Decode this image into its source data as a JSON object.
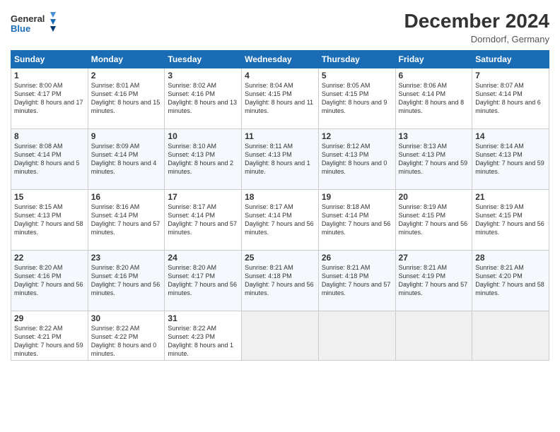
{
  "header": {
    "logo_line1": "General",
    "logo_line2": "Blue",
    "month_title": "December 2024",
    "location": "Dorndorf, Germany"
  },
  "days_of_week": [
    "Sunday",
    "Monday",
    "Tuesday",
    "Wednesday",
    "Thursday",
    "Friday",
    "Saturday"
  ],
  "weeks": [
    [
      {
        "day": "1",
        "sunrise": "8:00 AM",
        "sunset": "4:17 PM",
        "daylight": "8 hours and 17 minutes."
      },
      {
        "day": "2",
        "sunrise": "8:01 AM",
        "sunset": "4:16 PM",
        "daylight": "8 hours and 15 minutes."
      },
      {
        "day": "3",
        "sunrise": "8:02 AM",
        "sunset": "4:16 PM",
        "daylight": "8 hours and 13 minutes."
      },
      {
        "day": "4",
        "sunrise": "8:04 AM",
        "sunset": "4:15 PM",
        "daylight": "8 hours and 11 minutes."
      },
      {
        "day": "5",
        "sunrise": "8:05 AM",
        "sunset": "4:15 PM",
        "daylight": "8 hours and 9 minutes."
      },
      {
        "day": "6",
        "sunrise": "8:06 AM",
        "sunset": "4:14 PM",
        "daylight": "8 hours and 8 minutes."
      },
      {
        "day": "7",
        "sunrise": "8:07 AM",
        "sunset": "4:14 PM",
        "daylight": "8 hours and 6 minutes."
      }
    ],
    [
      {
        "day": "8",
        "sunrise": "8:08 AM",
        "sunset": "4:14 PM",
        "daylight": "8 hours and 5 minutes."
      },
      {
        "day": "9",
        "sunrise": "8:09 AM",
        "sunset": "4:14 PM",
        "daylight": "8 hours and 4 minutes."
      },
      {
        "day": "10",
        "sunrise": "8:10 AM",
        "sunset": "4:13 PM",
        "daylight": "8 hours and 2 minutes."
      },
      {
        "day": "11",
        "sunrise": "8:11 AM",
        "sunset": "4:13 PM",
        "daylight": "8 hours and 1 minute."
      },
      {
        "day": "12",
        "sunrise": "8:12 AM",
        "sunset": "4:13 PM",
        "daylight": "8 hours and 0 minutes."
      },
      {
        "day": "13",
        "sunrise": "8:13 AM",
        "sunset": "4:13 PM",
        "daylight": "7 hours and 59 minutes."
      },
      {
        "day": "14",
        "sunrise": "8:14 AM",
        "sunset": "4:13 PM",
        "daylight": "7 hours and 59 minutes."
      }
    ],
    [
      {
        "day": "15",
        "sunrise": "8:15 AM",
        "sunset": "4:13 PM",
        "daylight": "7 hours and 58 minutes."
      },
      {
        "day": "16",
        "sunrise": "8:16 AM",
        "sunset": "4:14 PM",
        "daylight": "7 hours and 57 minutes."
      },
      {
        "day": "17",
        "sunrise": "8:17 AM",
        "sunset": "4:14 PM",
        "daylight": "7 hours and 57 minutes."
      },
      {
        "day": "18",
        "sunrise": "8:17 AM",
        "sunset": "4:14 PM",
        "daylight": "7 hours and 56 minutes."
      },
      {
        "day": "19",
        "sunrise": "8:18 AM",
        "sunset": "4:14 PM",
        "daylight": "7 hours and 56 minutes."
      },
      {
        "day": "20",
        "sunrise": "8:19 AM",
        "sunset": "4:15 PM",
        "daylight": "7 hours and 56 minutes."
      },
      {
        "day": "21",
        "sunrise": "8:19 AM",
        "sunset": "4:15 PM",
        "daylight": "7 hours and 56 minutes."
      }
    ],
    [
      {
        "day": "22",
        "sunrise": "8:20 AM",
        "sunset": "4:16 PM",
        "daylight": "7 hours and 56 minutes."
      },
      {
        "day": "23",
        "sunrise": "8:20 AM",
        "sunset": "4:16 PM",
        "daylight": "7 hours and 56 minutes."
      },
      {
        "day": "24",
        "sunrise": "8:20 AM",
        "sunset": "4:17 PM",
        "daylight": "7 hours and 56 minutes."
      },
      {
        "day": "25",
        "sunrise": "8:21 AM",
        "sunset": "4:18 PM",
        "daylight": "7 hours and 56 minutes."
      },
      {
        "day": "26",
        "sunrise": "8:21 AM",
        "sunset": "4:18 PM",
        "daylight": "7 hours and 57 minutes."
      },
      {
        "day": "27",
        "sunrise": "8:21 AM",
        "sunset": "4:19 PM",
        "daylight": "7 hours and 57 minutes."
      },
      {
        "day": "28",
        "sunrise": "8:21 AM",
        "sunset": "4:20 PM",
        "daylight": "7 hours and 58 minutes."
      }
    ],
    [
      {
        "day": "29",
        "sunrise": "8:22 AM",
        "sunset": "4:21 PM",
        "daylight": "7 hours and 59 minutes."
      },
      {
        "day": "30",
        "sunrise": "8:22 AM",
        "sunset": "4:22 PM",
        "daylight": "8 hours and 0 minutes."
      },
      {
        "day": "31",
        "sunrise": "8:22 AM",
        "sunset": "4:23 PM",
        "daylight": "8 hours and 1 minute."
      },
      null,
      null,
      null,
      null
    ]
  ],
  "labels": {
    "sunrise": "Sunrise:",
    "sunset": "Sunset:",
    "daylight": "Daylight:"
  }
}
